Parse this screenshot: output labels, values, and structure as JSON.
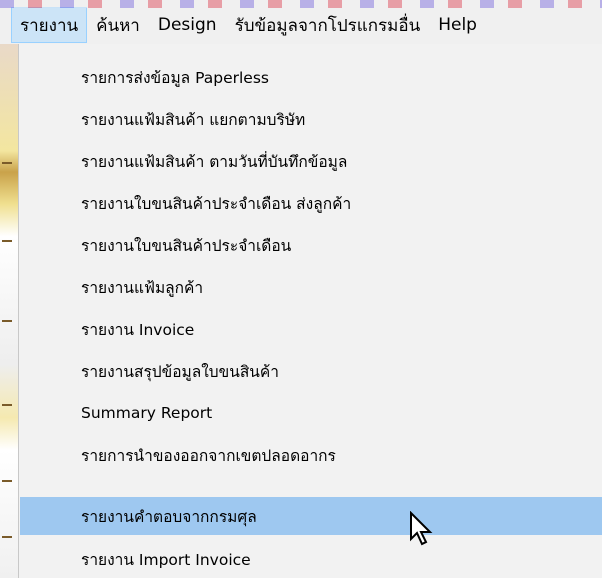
{
  "menubar": {
    "items": [
      {
        "label": "รายงาน",
        "active": true
      },
      {
        "label": "ค้นหา",
        "active": false
      },
      {
        "label": "Design",
        "active": false
      },
      {
        "label": "รับข้อมูลจากโปรแกรมอื่น",
        "active": false
      },
      {
        "label": "Help",
        "active": false
      }
    ]
  },
  "report_menu": {
    "items": [
      {
        "label": "รายการส่งข้อมูล Paperless",
        "hover": false
      },
      {
        "label": "รายงานแฟ้มสินค้า แยกตามบริษัท",
        "hover": false
      },
      {
        "label": "รายงานแฟ้มสินค้า ตามวันที่บันทึกข้อมูล",
        "hover": false
      },
      {
        "label": "รายงานใบขนสินค้าประจำเดือน ส่งลูกค้า",
        "hover": false
      },
      {
        "label": "รายงานใบขนสินค้าประจำเดือน",
        "hover": false
      },
      {
        "label": "รายงานแฟ้มลูกค้า",
        "hover": false
      },
      {
        "label": "รายงาน Invoice",
        "hover": false
      },
      {
        "label": "รายงานสรุปข้อมูลใบขนสินค้า",
        "hover": false
      },
      {
        "label": "Summary Report",
        "hover": false
      },
      {
        "label": "รายการนำของออกจากเขตปลอดอากร",
        "hover": false
      },
      {
        "label": "รายงานคำตอบจากกรมศุล",
        "hover": true
      },
      {
        "label": "รายงาน Import Invoice",
        "hover": false
      }
    ]
  },
  "colors": {
    "active_menu_bg": "#cce4f7",
    "active_menu_border": "#99d1ff",
    "hover_item_bg": "#9ec8f0",
    "menu_bg": "#f2f2f2"
  },
  "cursor_icon": "mouse-pointer-icon"
}
